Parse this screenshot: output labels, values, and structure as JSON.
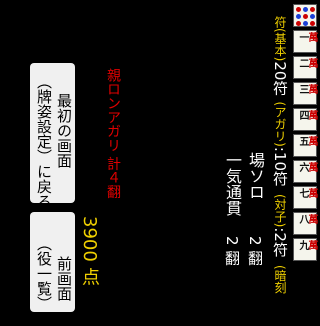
{
  "tiles": [
    {
      "type": "pin"
    },
    {
      "num": "一",
      "suit": "萬"
    },
    {
      "num": "二",
      "suit": "萬"
    },
    {
      "num": "三",
      "suit": "萬"
    },
    {
      "num": "四",
      "suit": "萬"
    },
    {
      "num": "五",
      "suit": "萬"
    },
    {
      "num": "六",
      "suit": "萬"
    },
    {
      "num": "七",
      "suit": "萬"
    },
    {
      "num": "八",
      "suit": "萬"
    },
    {
      "num": "九",
      "suit": "萬"
    }
  ],
  "fu": {
    "base_label": "符(基本)",
    "base_value": "20符",
    "agari_label": "(アガリ)",
    "agari_value": ":10符",
    "toitsu_label": "(対子)",
    "toitsu_value": ":2符",
    "last_label": "(暗刻"
  },
  "yaku": [
    {
      "name": "場ソロ",
      "han": "2 翻"
    },
    {
      "name": "一気通貫",
      "han": "2 翻"
    }
  ],
  "total_label": "親ロンアガリ 計４翻",
  "points": "3900 点",
  "buttons": {
    "back_to_first": "最初の画面\n（牌姿設定）に戻る",
    "back_line1": "最初の画面",
    "back_line2": "（牌姿設定）に戻る",
    "prev_line1": "前画面",
    "prev_line2": "（役一覧）に"
  }
}
